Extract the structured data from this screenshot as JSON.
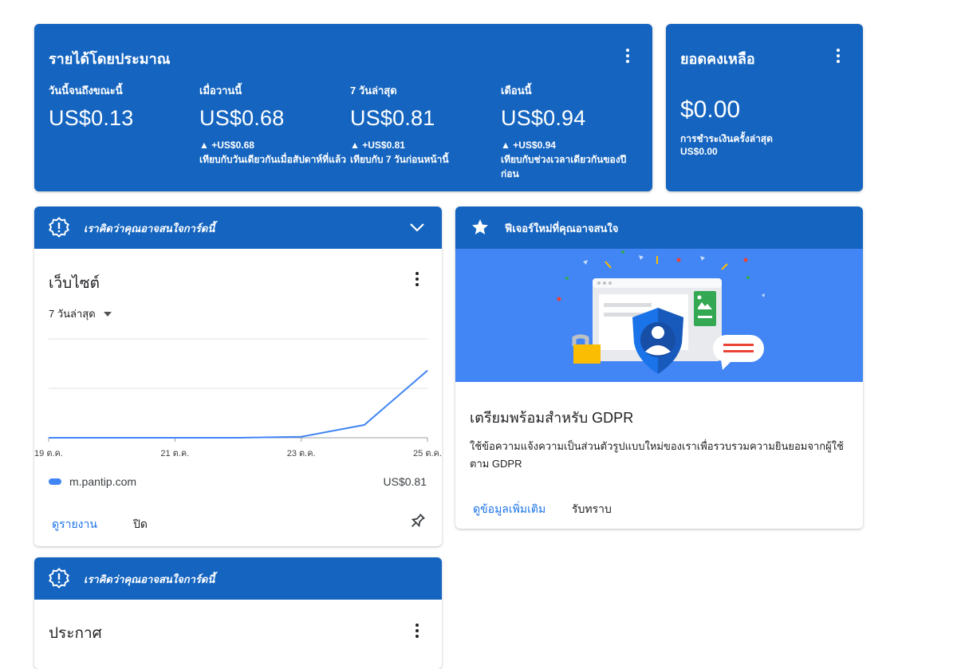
{
  "estimated_earnings": {
    "title": "รายได้โดยประมาณ",
    "metrics": [
      {
        "label": "วันนี้จนถึงขณะนี้",
        "value": "US$0.13",
        "change": "",
        "compare": ""
      },
      {
        "label": "เมื่อวานนี้",
        "value": "US$0.68",
        "change": "▲ +US$0.68",
        "compare": "เทียบกับวันเดียวกันเมื่อสัปดาห์ที่แล้ว"
      },
      {
        "label": "7 วันล่าสุด",
        "value": "US$0.81",
        "change": "▲ +US$0.81",
        "compare": "เทียบกับ 7 วันก่อนหน้านี้"
      },
      {
        "label": "เดือนนี้",
        "value": "US$0.94",
        "change": "▲ +US$0.94",
        "compare": "เทียบกับช่วงเวลาเดียวกันของปีก่อน"
      }
    ]
  },
  "balance": {
    "title": "ยอดคงเหลือ",
    "value": "$0.00",
    "last_payment_label": "การชำระเงินครั้งล่าสุด",
    "last_payment_value": "US$0.00"
  },
  "sites_card": {
    "header": "เราคิดว่าคุณอาจสนใจการ์ดนี้",
    "title": "เว็บไซต์",
    "range": "7 วันล่าสุด",
    "legend_site": "m.pantip.com",
    "legend_value": "US$0.81",
    "report_label": "ดูรายงาน",
    "close_label": "ปิด",
    "colors": {
      "line": "#4285f4"
    }
  },
  "chart_data": {
    "type": "line",
    "x": [
      "19 ต.ค.",
      "20 ต.ค.",
      "21 ต.ค.",
      "22 ต.ค.",
      "23 ต.ค.",
      "24 ต.ค.",
      "25 ต.ค."
    ],
    "tick_labels": [
      "19 ต.ค.",
      "21 ต.ค.",
      "23 ต.ค.",
      "25 ต.ค."
    ],
    "series": [
      {
        "name": "m.pantip.com",
        "values": [
          0,
          0,
          0,
          0,
          0.01,
          0.13,
          0.68
        ]
      }
    ],
    "ylim": [
      0,
      1.0
    ],
    "grid": true
  },
  "feature_card": {
    "header": "ฟีเจอร์ใหม่ที่คุณอาจสนใจ",
    "title": "เตรียมพร้อมสำหรับ GDPR",
    "body": "ใช้ข้อความแจ้งความเป็นส่วนตัวรูปแบบใหม่ของเราเพื่อรวบรวมความยินยอมจากผู้ใช้ตาม GDPR",
    "learn_more": "ดูข้อมูลเพิ่มเติม",
    "dismiss": "รับทราบ",
    "colors": {
      "illustration_bg": "#4285f4"
    }
  },
  "announcement_card": {
    "header": "เราคิดว่าคุณอาจสนใจการ์ดนี้",
    "title": "ประกาศ"
  }
}
